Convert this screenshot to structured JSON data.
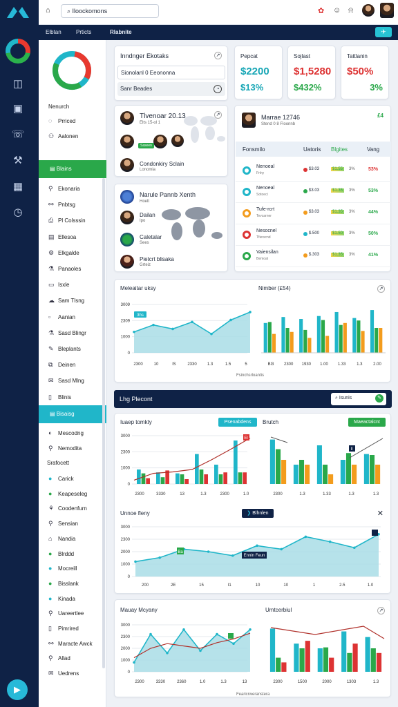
{
  "topbar": {
    "search_value": "Iloockomons"
  },
  "nav": {
    "items": [
      "Elbtan",
      "Prticts",
      "Rlabnite"
    ]
  },
  "sidebar": {
    "header": "Nenurch",
    "items_top": [
      "Prriced",
      "Aalonen"
    ],
    "selected_green": "Blains",
    "items_mid": [
      "Ekonaria",
      "Pnbtsg",
      "Pl Colsssin",
      "Ellesoa",
      "Elkgalde",
      "Panaoles",
      "Isxle",
      "Sam Tlsng",
      "Aanian",
      "Sasd Blingr",
      "Bleplants",
      "Deinen",
      "Sasd Mlng",
      "Blinis"
    ],
    "selected_teal": "Bisaisg",
    "items_low": [
      "Mescodng",
      "Nemodita"
    ],
    "section": "Srafocett",
    "items_bottom": [
      "Carick",
      "Keapeseleg",
      "Coodenfurn",
      "Sensian",
      "Nandia",
      "Blrddd",
      "Mocreill",
      "Bisslank",
      "Kinada",
      "Uareertlee",
      "Pimrired",
      "Maracte Awck",
      "Allad",
      "Uedrens"
    ]
  },
  "kpi": {
    "title": "Inndnger Ekotaks",
    "field1": "Sionolanl 0 Eeononna",
    "field2": "Sanr Beades",
    "cards": [
      {
        "label": "Pepcat",
        "v1": "$2200",
        "v2": "$13%",
        "c1": "#17a6b5",
        "c2": "#17a6b5"
      },
      {
        "label": "Sojlast",
        "v1": "$1,5280",
        "v2": "$432%",
        "c1": "#d33",
        "c2": "#2aa84a"
      },
      {
        "label": "Tattlanin",
        "v1": "$50%",
        "v2": "3%",
        "c1": "#d33",
        "c2": "#2aa84a"
      }
    ]
  },
  "people1": {
    "title": "Tlvenoar 20.13",
    "sub": "Elts 15-ol 1",
    "badge": "Saseen",
    "person": "Condonkiry Sclain",
    "person_sub": "Lonomia"
  },
  "people2": {
    "title": "Narule Pannb Xenth",
    "sub": "Hoelt",
    "people": [
      {
        "name": "Dailan",
        "sub": "Ipo"
      },
      {
        "name": "Caletalar",
        "sub": "Sees"
      },
      {
        "name": "Pietcrt blisaka",
        "sub": "Grteiz"
      }
    ]
  },
  "table": {
    "title": "Marrae 12746",
    "sub": "Stend 0 8 Floonnb",
    "badge": "£4",
    "columns": [
      "Fonsmilo",
      "Uatoris",
      "Blgites",
      "Vang"
    ],
    "rows": [
      {
        "name": "Nenoeal",
        "sub": "Fnhy",
        "ic": "#20b6c9",
        "d": "#d33",
        "a": "$3.03",
        "b": "$1.55",
        "c": "3%",
        "v": "53%",
        "vc": "#d33"
      },
      {
        "name": "Nenoeal",
        "sub": "Sotoeci",
        "ic": "#20b6c9",
        "d": "#2aa84a",
        "a": "$3.03",
        "b": "$1.35",
        "c": "3%",
        "v": "53%",
        "vc": "#2aa84a"
      },
      {
        "name": "Tufe-rcrt",
        "sub": "Tevcarner",
        "ic": "#f39c1d",
        "d": "#f39c1d",
        "a": "$3.03",
        "b": "$1.35",
        "c": "3%",
        "v": "44%",
        "vc": "#2aa84a"
      },
      {
        "name": "Nesocnel",
        "sub": "Tfierscnd",
        "ic": "#d33",
        "d": "#20b6c9",
        "a": "$.500",
        "b": "$1.50",
        "c": "3%",
        "v": "50%",
        "vc": "#2aa84a"
      },
      {
        "name": "Vaiensilan",
        "sub": "Bemoal",
        "ic": "#2aa84a",
        "d": "#f39c1d",
        "a": "$.303",
        "b": "$1.35",
        "c": "3%",
        "v": "41%",
        "vc": "#2aa84a"
      }
    ]
  },
  "chartpanel": {
    "title1": "Meleaitar uksy",
    "title2": "Nimber (£54)",
    "footer": "Fsinchsrloantis",
    "badge": "3hs"
  },
  "section": {
    "title": "Lhg Plecont",
    "search": "Isunis"
  },
  "report": {
    "title": "Iuaep tomkty",
    "btn": "Psenabdens",
    "title2": "Brutch",
    "btn2": "Maeactalcnt",
    "flag": "El",
    "flag2": "Il"
  },
  "area": {
    "title": "Unnoe fleny",
    "btn": "Blhnlen",
    "label": "Ennin Feun",
    "flag": "Ba"
  },
  "bottom": {
    "title": "Mauay Mcyany",
    "title2": "Umtcerbiul",
    "footer": "Fearicrweranstera"
  },
  "chart_data": [
    {
      "type": "line",
      "title": "Meleaitar uksy",
      "x": [
        "2300",
        "10",
        "lS",
        "2330",
        "1.3",
        "1.5",
        "5"
      ],
      "y": [
        0.42,
        0.56,
        0.48,
        0.62,
        0.38,
        0.66,
        0.82
      ],
      "color": "#20b6c9",
      "yticks": [
        "3009",
        "2309",
        "1000",
        "0"
      ]
    },
    {
      "type": "bar",
      "title": "Nimber (£54)",
      "categories": [
        "Bl3",
        "2300",
        "1930",
        "1.00",
        "1.33",
        "1.3",
        "2.00"
      ],
      "series": [
        {
          "name": "",
          "values": [
            0.6,
            0.72,
            0.68,
            0.74,
            0.82,
            0.7,
            0.86
          ],
          "color": "#20b6c9"
        },
        {
          "name": "",
          "values": [
            0.62,
            0.5,
            0.46,
            0.66,
            0.56,
            0.65,
            0.5
          ],
          "color": "#2aa84a"
        },
        {
          "name": "",
          "values": [
            0.38,
            0.42,
            0.3,
            0.34,
            0.6,
            0.44,
            0.5
          ],
          "color": "#f39c1d"
        }
      ]
    },
    {
      "type": "bar",
      "title": "Iuaep tomkty",
      "categories": [
        "2300",
        "3330",
        "13",
        "1.3",
        "2300",
        "1.0"
      ],
      "series": [
        {
          "name": "",
          "values": [
            0.3,
            0.24,
            0.22,
            0.62,
            0.4,
            0.9
          ],
          "color": "#20b6c9"
        },
        {
          "name": "",
          "values": [
            0.22,
            0.14,
            0.2,
            0.3,
            0.2,
            0.24
          ],
          "color": "#2aa84a"
        },
        {
          "name": "",
          "values": [
            0.12,
            0.28,
            0.1,
            0.2,
            0.24,
            0.24
          ],
          "color": "#d33"
        }
      ],
      "trend": [
        0.08,
        0.22,
        0.25,
        0.3,
        0.5,
        0.72,
        0.95
      ]
    },
    {
      "type": "bar",
      "title": "Brutch",
      "categories": [
        "2300",
        "1.3",
        "1.33",
        "1.3",
        "1.3"
      ],
      "series": [
        {
          "name": "",
          "values": [
            0.92,
            0.4,
            0.8,
            0.5,
            0.62
          ],
          "color": "#20b6c9"
        },
        {
          "name": "",
          "values": [
            0.72,
            0.5,
            0.4,
            0.64,
            0.6
          ],
          "color": "#2aa84a"
        },
        {
          "name": "",
          "values": [
            0.5,
            0.4,
            0.2,
            0.4,
            0.4
          ],
          "color": "#f39c1d"
        }
      ]
    },
    {
      "type": "area",
      "title": "Unnoe fleny",
      "x": [
        "200",
        "2E",
        "15",
        "I1",
        "10",
        "10",
        "1",
        "2.5",
        "1.0"
      ],
      "y": [
        0.3,
        0.38,
        0.55,
        0.5,
        0.42,
        0.62,
        0.55,
        0.8,
        0.7,
        0.58,
        0.85
      ],
      "yticks": [
        "3000",
        "2300",
        "2000",
        "1000",
        "0"
      ]
    },
    {
      "type": "area",
      "title": "Mauay Mcyany",
      "x": [
        "2300",
        "3330",
        "2360",
        "1.0",
        "1.3",
        "13"
      ],
      "y": [
        0.2,
        0.8,
        0.4,
        0.9,
        0.45,
        0.8,
        0.6,
        0.9
      ],
      "trend": [
        0.3,
        0.5,
        0.6,
        0.55,
        0.5,
        0.62,
        0.7,
        0.82
      ],
      "yticks": [
        "3000",
        "2300",
        "2000",
        "1000",
        "0"
      ]
    },
    {
      "type": "bar",
      "title": "Umtcerbiul",
      "categories": [
        "2300",
        "1500",
        "2000",
        "1303",
        "1.3"
      ],
      "series": [
        {
          "name": "",
          "values": [
            0.92,
            0.6,
            0.5,
            0.86,
            0.74
          ],
          "color": "#20b6c9"
        },
        {
          "name": "",
          "values": [
            0.3,
            0.5,
            0.52,
            0.4,
            0.5
          ],
          "color": "#2aa84a"
        },
        {
          "name": "",
          "values": [
            0.2,
            0.66,
            0.3,
            0.6,
            0.4
          ],
          "color": "#d33"
        }
      ]
    }
  ]
}
